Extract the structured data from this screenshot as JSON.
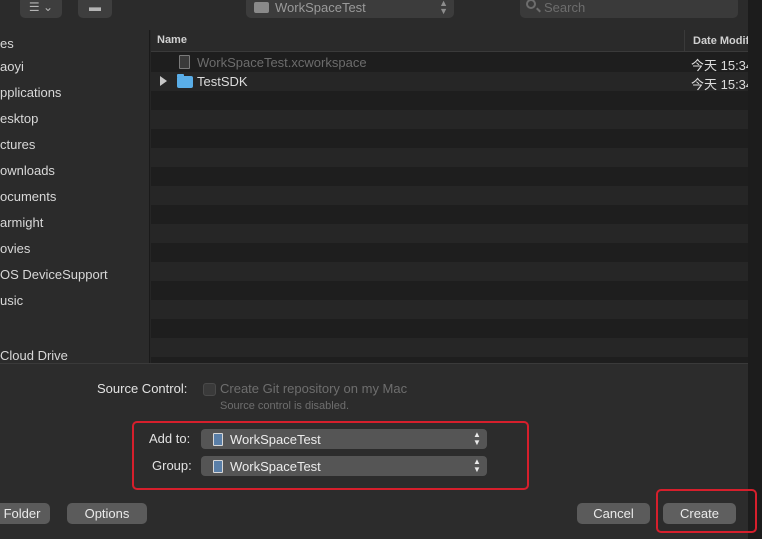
{
  "toolbar": {
    "view_icon": "list-view-icon",
    "folder_icon": "folder-icon",
    "path_value": "WorkSpaceTest",
    "search_placeholder": "Search"
  },
  "sidebar": {
    "items": [
      {
        "label": "es",
        "icon": "section-header"
      },
      {
        "label": "aoyi",
        "icon": "home-icon"
      },
      {
        "label": "pplications",
        "icon": "applications-icon"
      },
      {
        "label": "esktop",
        "icon": "desktop-icon"
      },
      {
        "label": "ctures",
        "icon": "pictures-icon"
      },
      {
        "label": "ownloads",
        "icon": "downloads-icon"
      },
      {
        "label": "ocuments",
        "icon": "documents-icon"
      },
      {
        "label": "armight",
        "icon": "folder-icon"
      },
      {
        "label": "ovies",
        "icon": "movies-icon"
      },
      {
        "label": "OS DeviceSupport",
        "icon": "folder-icon"
      },
      {
        "label": "usic",
        "icon": "music-icon"
      },
      {
        "label": "Cloud Drive",
        "icon": "cloud-icon"
      }
    ]
  },
  "filelist": {
    "columns": {
      "name": "Name",
      "date": "Date Modifi"
    },
    "rows": [
      {
        "name": "WorkSpaceTest.xcworkspace",
        "date": "今天 15:34",
        "type": "workspace",
        "disabled": true
      },
      {
        "name": "TestSDK",
        "date": "今天 15:34",
        "type": "folder",
        "disabled": false
      }
    ]
  },
  "options": {
    "source_control_label": "Source Control:",
    "git_checkbox_label": "Create Git repository on my Mac",
    "git_checkbox_checked": false,
    "git_note": "Source control is disabled.",
    "add_to_label": "Add to:",
    "add_to_value": "WorkSpaceTest",
    "group_label": "Group:",
    "group_value": "WorkSpaceTest",
    "highlight_color": "#d61f2c"
  },
  "buttons": {
    "new_folder": "Folder",
    "options": "Options",
    "cancel": "Cancel",
    "create": "Create"
  }
}
